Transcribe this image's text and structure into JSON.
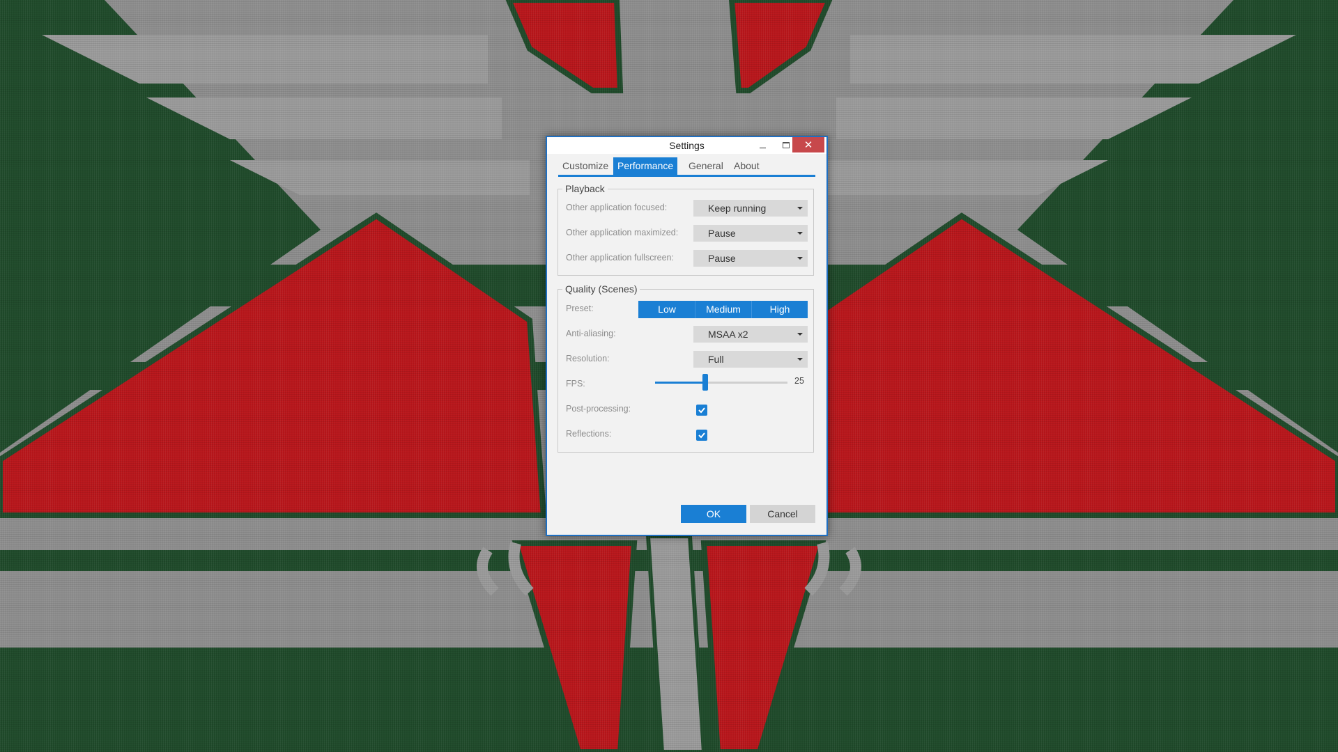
{
  "window": {
    "title": "Settings"
  },
  "tabs": [
    {
      "label": "Customize",
      "active": false
    },
    {
      "label": "Performance",
      "active": true
    },
    {
      "label": "General",
      "active": false
    },
    {
      "label": "About",
      "active": false
    }
  ],
  "playback": {
    "title": "Playback",
    "rows": [
      {
        "label": "Other application focused:",
        "value": "Keep running"
      },
      {
        "label": "Other application maximized:",
        "value": "Pause"
      },
      {
        "label": "Other application fullscreen:",
        "value": "Pause"
      }
    ]
  },
  "quality": {
    "title": "Quality (Scenes)",
    "preset_label": "Preset:",
    "preset_options": [
      "Low",
      "Medium",
      "High"
    ],
    "antialiasing_label": "Anti-aliasing:",
    "antialiasing_value": "MSAA x2",
    "resolution_label": "Resolution:",
    "resolution_value": "Full",
    "fps_label": "FPS:",
    "fps_value": "25",
    "fps_fraction": 0.38,
    "postprocessing_label": "Post-processing:",
    "postprocessing_checked": true,
    "reflections_label": "Reflections:",
    "reflections_checked": true
  },
  "buttons": {
    "ok": "OK",
    "cancel": "Cancel"
  },
  "colors": {
    "accent": "#1a7fd4",
    "close": "#c7484b",
    "wallpaper_red": "#b8161b",
    "wallpaper_green": "#1f4a2a",
    "wallpaper_gray": "#8d8d8d"
  }
}
